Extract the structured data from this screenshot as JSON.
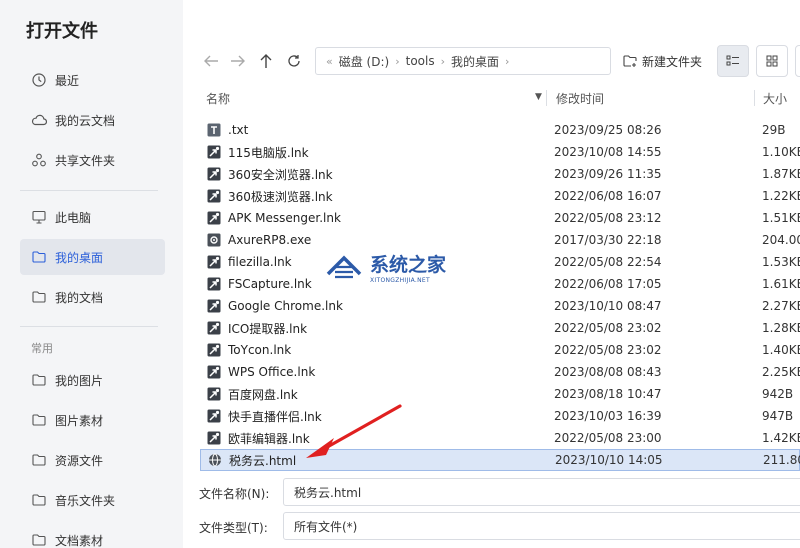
{
  "dialog": {
    "title": "打开文件"
  },
  "sidebar": {
    "items": [
      {
        "label": "最近",
        "icon": "clock-icon"
      },
      {
        "label": "我的云文档",
        "icon": "cloud-icon"
      },
      {
        "label": "共享文件夹",
        "icon": "share-icon"
      },
      {
        "label": "此电脑",
        "icon": "monitor-icon"
      },
      {
        "label": "我的桌面",
        "icon": "folder-icon",
        "active": true
      },
      {
        "label": "我的文档",
        "icon": "folder-icon"
      }
    ],
    "section_label": "常用",
    "common_items": [
      {
        "label": "我的图片",
        "icon": "folder-icon"
      },
      {
        "label": "图片素材",
        "icon": "folder-icon"
      },
      {
        "label": "资源文件",
        "icon": "folder-icon"
      },
      {
        "label": "音乐文件夹",
        "icon": "folder-icon"
      },
      {
        "label": "文档素材",
        "icon": "folder-icon"
      }
    ]
  },
  "toolbar": {
    "breadcrumb": [
      "磁盘 (D:)",
      "tools",
      "我的桌面"
    ],
    "new_folder_label": "新建文件夹"
  },
  "columns": {
    "name": "名称",
    "modified": "修改时间",
    "size": "大小"
  },
  "files": [
    {
      "name": ".txt",
      "date": "2023/09/25 08:26",
      "size": "29B",
      "icon": "text-file-icon"
    },
    {
      "name": "115电脑版.lnk",
      "date": "2023/10/08 14:55",
      "size": "1.10KB",
      "icon": "shortcut-icon"
    },
    {
      "name": "360安全浏览器.lnk",
      "date": "2023/09/26 11:35",
      "size": "1.87KB",
      "icon": "shortcut-icon"
    },
    {
      "name": "360极速浏览器.lnk",
      "date": "2022/06/08 16:07",
      "size": "1.22KB",
      "icon": "shortcut-icon"
    },
    {
      "name": "APK Messenger.lnk",
      "date": "2022/05/08 23:12",
      "size": "1.51KB",
      "icon": "shortcut-icon"
    },
    {
      "name": "AxureRP8.exe",
      "date": "2017/03/30 22:18",
      "size": "204.00",
      "icon": "exe-icon"
    },
    {
      "name": "filezilla.lnk",
      "date": "2022/05/08 22:54",
      "size": "1.53KB",
      "icon": "shortcut-icon"
    },
    {
      "name": "FSCapture.lnk",
      "date": "2022/06/08 17:05",
      "size": "1.61KB",
      "icon": "shortcut-icon"
    },
    {
      "name": "Google Chrome.lnk",
      "date": "2023/10/10 08:47",
      "size": "2.27KB",
      "icon": "shortcut-icon"
    },
    {
      "name": "ICO提取器.lnk",
      "date": "2022/05/08 23:02",
      "size": "1.28KB",
      "icon": "shortcut-icon"
    },
    {
      "name": "ToYcon.lnk",
      "date": "2022/05/08 23:02",
      "size": "1.40KB",
      "icon": "shortcut-icon"
    },
    {
      "name": "WPS Office.lnk",
      "date": "2023/08/08 08:43",
      "size": "2.25KB",
      "icon": "shortcut-icon"
    },
    {
      "name": "百度网盘.lnk",
      "date": "2023/08/18 10:47",
      "size": "942B",
      "icon": "shortcut-icon"
    },
    {
      "name": "快手直播伴侣.lnk",
      "date": "2023/10/03 16:39",
      "size": "947B",
      "icon": "shortcut-icon"
    },
    {
      "name": "欧菲编辑器.lnk",
      "date": "2022/05/08 23:00",
      "size": "1.42KB",
      "icon": "shortcut-icon"
    },
    {
      "name": "税务云.html",
      "date": "2023/10/10 14:05",
      "size": "211.80",
      "icon": "globe-icon",
      "selected": true
    }
  ],
  "bottom": {
    "filename_label": "文件名称(N):",
    "filename_value": "税务云.html",
    "filetype_label": "文件类型(T):",
    "filetype_value": "所有文件(*)"
  },
  "watermark": {
    "main": "系统之家",
    "sub": "XITONGZHIJIA.NET"
  },
  "colors": {
    "accent": "#2b5fd9",
    "arrow": "#e02020",
    "selected_row": "#dbe6f7",
    "sidebar_bg": "#f4f5f7"
  }
}
